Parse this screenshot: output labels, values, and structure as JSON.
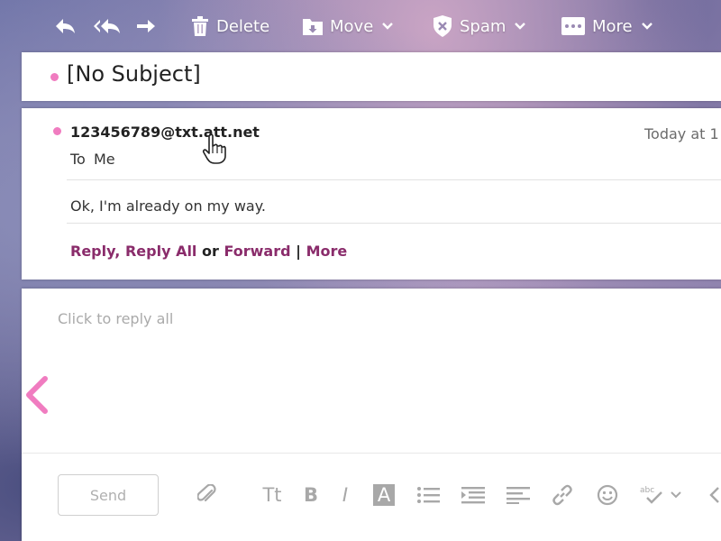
{
  "toolbar": {
    "back_icon": "reply-icon",
    "reply_all_icon": "reply-all-icon",
    "forward_icon": "forward-icon",
    "delete_label": "Delete",
    "move_label": "Move",
    "spam_label": "Spam",
    "more_label": "More"
  },
  "subject": "[No Subject]",
  "message": {
    "sender": "123456789@txt.att.net",
    "date": "Today at 1",
    "to_label": "To",
    "to_value": "Me",
    "body": "Ok, I'm already on my way.",
    "actions": {
      "reply": "Reply",
      "reply_all": "Reply All",
      "or": "or",
      "forward": "Forward",
      "separator": "|",
      "more": "More"
    }
  },
  "reply": {
    "placeholder": "Click to reply all",
    "send_label": "Send",
    "format_font": "Tt",
    "format_bold": "B",
    "format_italic": "I",
    "format_color": "A"
  },
  "colors": {
    "accent_pink": "#f07cc0",
    "link_purple": "#8a2c6b"
  }
}
